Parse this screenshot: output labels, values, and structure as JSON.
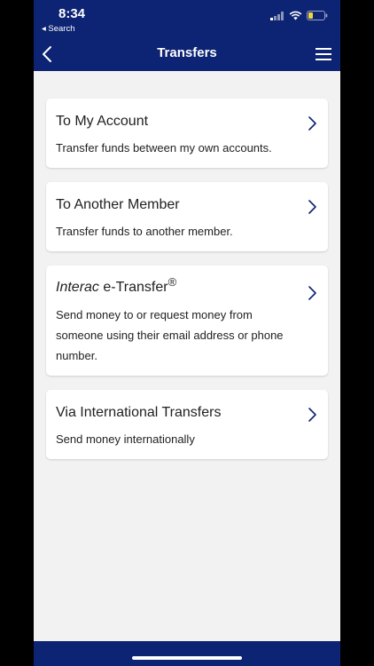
{
  "status": {
    "time": "8:34",
    "back_app": "◂ Search"
  },
  "nav": {
    "title": "Transfers"
  },
  "cards": [
    {
      "title": "To My Account",
      "description": "Transfer funds between my own accounts."
    },
    {
      "title": "To Another Member",
      "description": "Transfer funds to another member."
    },
    {
      "title_italic": "Interac",
      "title_rest": " e-Transfer",
      "title_mark": "®",
      "description": "Send money to or request money from someone using their email address or phone number."
    },
    {
      "title": "Via International Transfers",
      "description": "Send money internationally"
    }
  ],
  "colors": {
    "brand": "#0d2373",
    "background": "#f2f2f2",
    "chevron": "#0d2373"
  }
}
